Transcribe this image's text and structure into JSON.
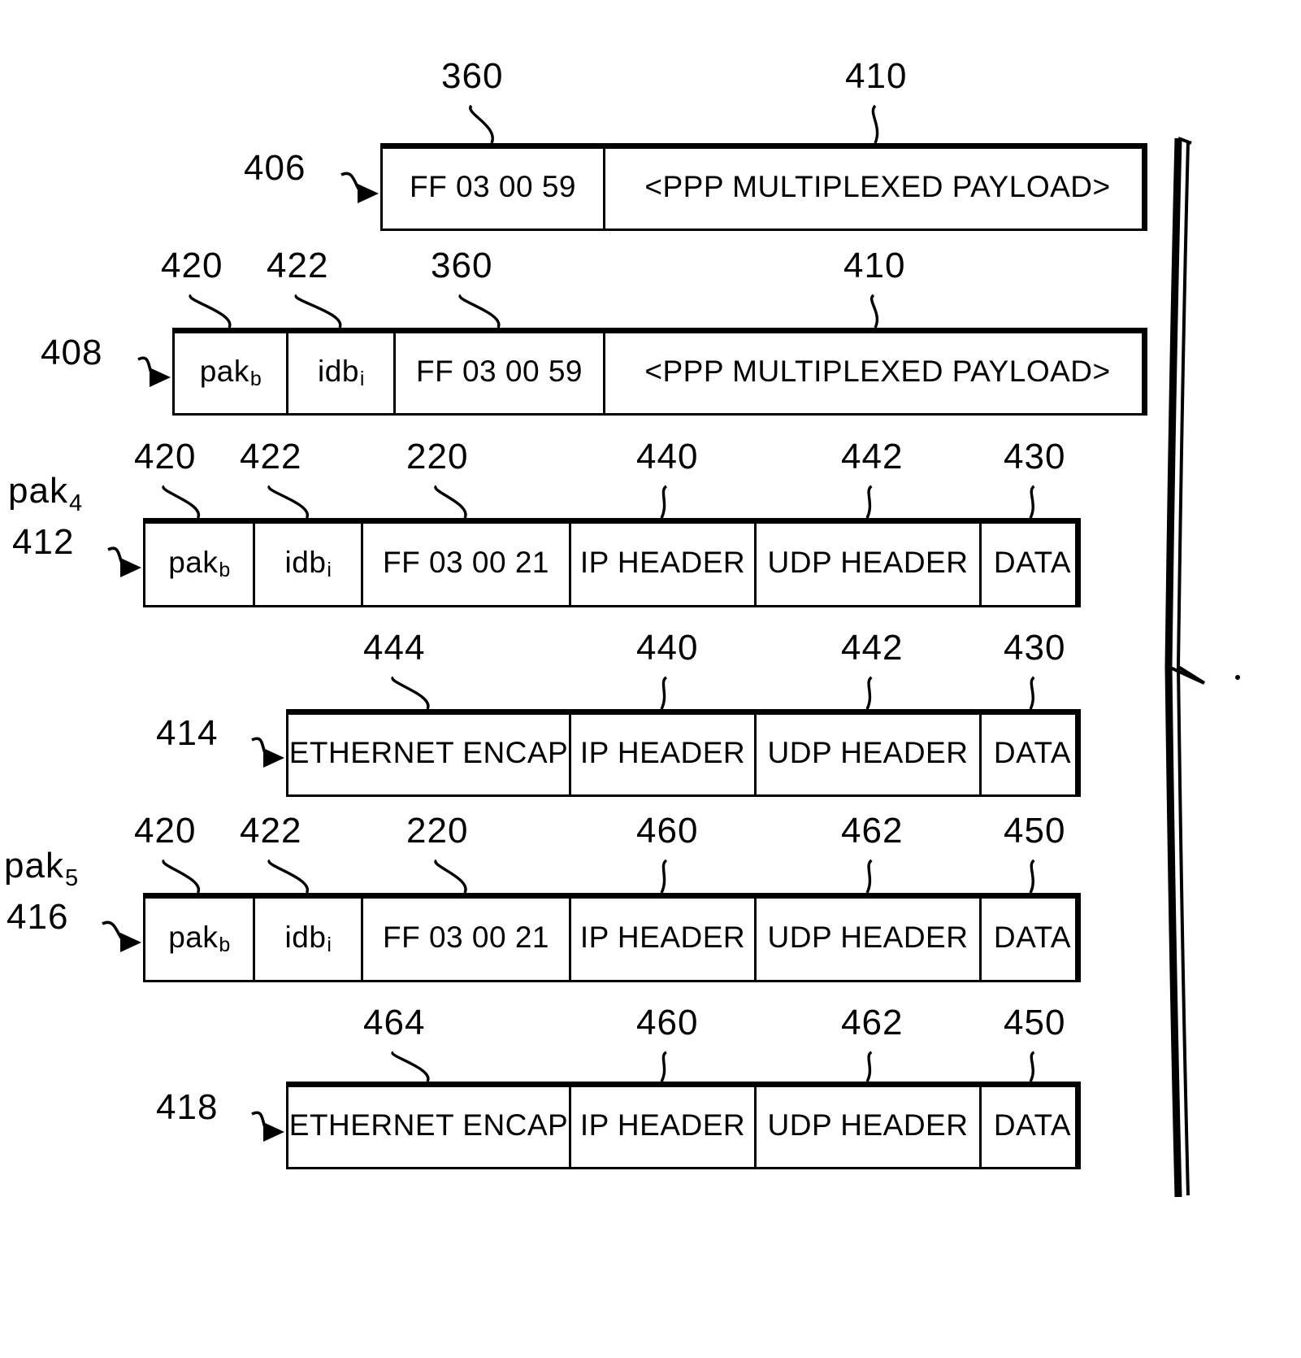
{
  "figure": {
    "type": "patent-packet-encapsulation-diagram",
    "brace_label": ""
  },
  "rows": [
    {
      "id": "row-406",
      "callout": "406",
      "left_label": "",
      "left_label_sub": "",
      "cells": [
        {
          "text": "FF  03  00  59",
          "sub": "",
          "ref": "360"
        },
        {
          "text": "<PPP  MULTIPLEXED  PAYLOAD>",
          "sub": "",
          "ref": "410"
        }
      ]
    },
    {
      "id": "row-408",
      "callout": "408",
      "left_label": "",
      "left_label_sub": "",
      "cells": [
        {
          "text": "pak",
          "sub": "b",
          "ref": "420"
        },
        {
          "text": "idb",
          "sub": "i",
          "ref": "422"
        },
        {
          "text": "FF  03  00  59",
          "sub": "",
          "ref": "360"
        },
        {
          "text": "<PPP  MULTIPLEXED  PAYLOAD>",
          "sub": "",
          "ref": "410"
        }
      ]
    },
    {
      "id": "row-412",
      "callout": "412",
      "left_label": "pak",
      "left_label_sub": "4",
      "cells": [
        {
          "text": "pak",
          "sub": "b",
          "ref": "420"
        },
        {
          "text": "idb",
          "sub": "i",
          "ref": "422"
        },
        {
          "text": "FF  03  00  21",
          "sub": "",
          "ref": "220"
        },
        {
          "text": "IP  HEADER",
          "sub": "",
          "ref": "440"
        },
        {
          "text": "UDP  HEADER",
          "sub": "",
          "ref": "442"
        },
        {
          "text": "DATA",
          "sub": "",
          "ref": "430"
        }
      ]
    },
    {
      "id": "row-414",
      "callout": "414",
      "left_label": "",
      "left_label_sub": "",
      "cells": [
        {
          "text": "ETHERNET  ENCAP",
          "sub": "",
          "ref": "444"
        },
        {
          "text": "IP  HEADER",
          "sub": "",
          "ref": "440"
        },
        {
          "text": "UDP  HEADER",
          "sub": "",
          "ref": "442"
        },
        {
          "text": "DATA",
          "sub": "",
          "ref": "430"
        }
      ]
    },
    {
      "id": "row-416",
      "callout": "416",
      "left_label": "pak",
      "left_label_sub": "5",
      "cells": [
        {
          "text": "pak",
          "sub": "b",
          "ref": "420"
        },
        {
          "text": "idb",
          "sub": "i",
          "ref": "422"
        },
        {
          "text": "FF  03  00  21",
          "sub": "",
          "ref": "220"
        },
        {
          "text": "IP  HEADER",
          "sub": "",
          "ref": "460"
        },
        {
          "text": "UDP  HEADER",
          "sub": "",
          "ref": "462"
        },
        {
          "text": "DATA",
          "sub": "",
          "ref": "450"
        }
      ]
    },
    {
      "id": "row-418",
      "callout": "418",
      "left_label": "",
      "left_label_sub": "",
      "cells": [
        {
          "text": "ETHERNET  ENCAP",
          "sub": "",
          "ref": "464"
        },
        {
          "text": "IP  HEADER",
          "sub": "",
          "ref": "460"
        },
        {
          "text": "UDP  HEADER",
          "sub": "",
          "ref": "462"
        },
        {
          "text": "DATA",
          "sub": "",
          "ref": "450"
        }
      ]
    }
  ]
}
